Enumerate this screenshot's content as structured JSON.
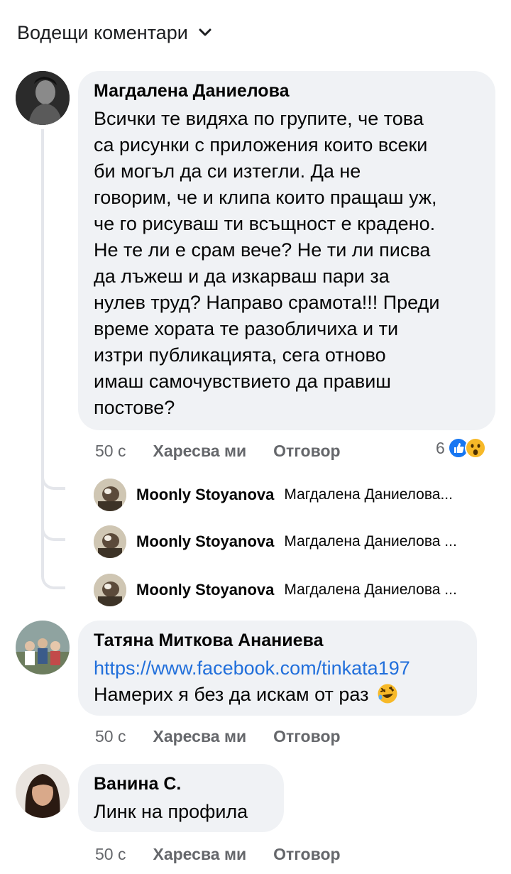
{
  "header": {
    "sort_label": "Водещи коментари",
    "sort_icon": "chevron-down-icon"
  },
  "comments": [
    {
      "author": "Магдалена Даниелова",
      "lines": [
        "Всички те видяха по групите, че това",
        "са рисунки с приложения които всеки",
        "би могъл да си изтегли. Да не",
        "говорим, че и клипа които пращаш уж,",
        "че го рисуваш ти всъщност е крадено.",
        "Не те ли е срам вече? Не ти ли писва",
        "да лъжеш и да изкарваш пари за",
        "нулев труд? Направо срамота!!! Преди",
        "време хората те разобличиха и ти",
        "изтри публикацията, сега отново",
        "имаш самочувствието да правиш",
        "постове?"
      ],
      "time": "50 с",
      "like_label": "Харесва ми",
      "reply_label": "Отговор",
      "reaction_count": "6",
      "reaction_icons": [
        "like-icon",
        "wow-icon"
      ],
      "replies": [
        {
          "author": "Moonly Stoyanova",
          "preview": "Магдалена Даниелова..."
        },
        {
          "author": "Moonly Stoyanova",
          "preview": "Магдалена Даниелова ..."
        },
        {
          "author": "Moonly Stoyanova",
          "preview": "Магдалена Даниелова ..."
        }
      ]
    },
    {
      "author": "Татяна Миткова Ананиева",
      "link": "https://www.facebook.com/tinkata197",
      "text": "Намерих я без да  искам от раз",
      "emoji_icon": "rolling-laughing-icon",
      "time": "50 с",
      "like_label": "Харесва ми",
      "reply_label": "Отговор"
    },
    {
      "author": "Ванина С.",
      "text": "Линк на профила",
      "time": "50 с",
      "like_label": "Харесва ми",
      "reply_label": "Отговор"
    }
  ],
  "colors": {
    "bubble": "#f0f2f5",
    "link": "#216fdb",
    "meta": "#65676b",
    "like_blue": "#1877f2",
    "wow_yellow": "#f7b928"
  }
}
